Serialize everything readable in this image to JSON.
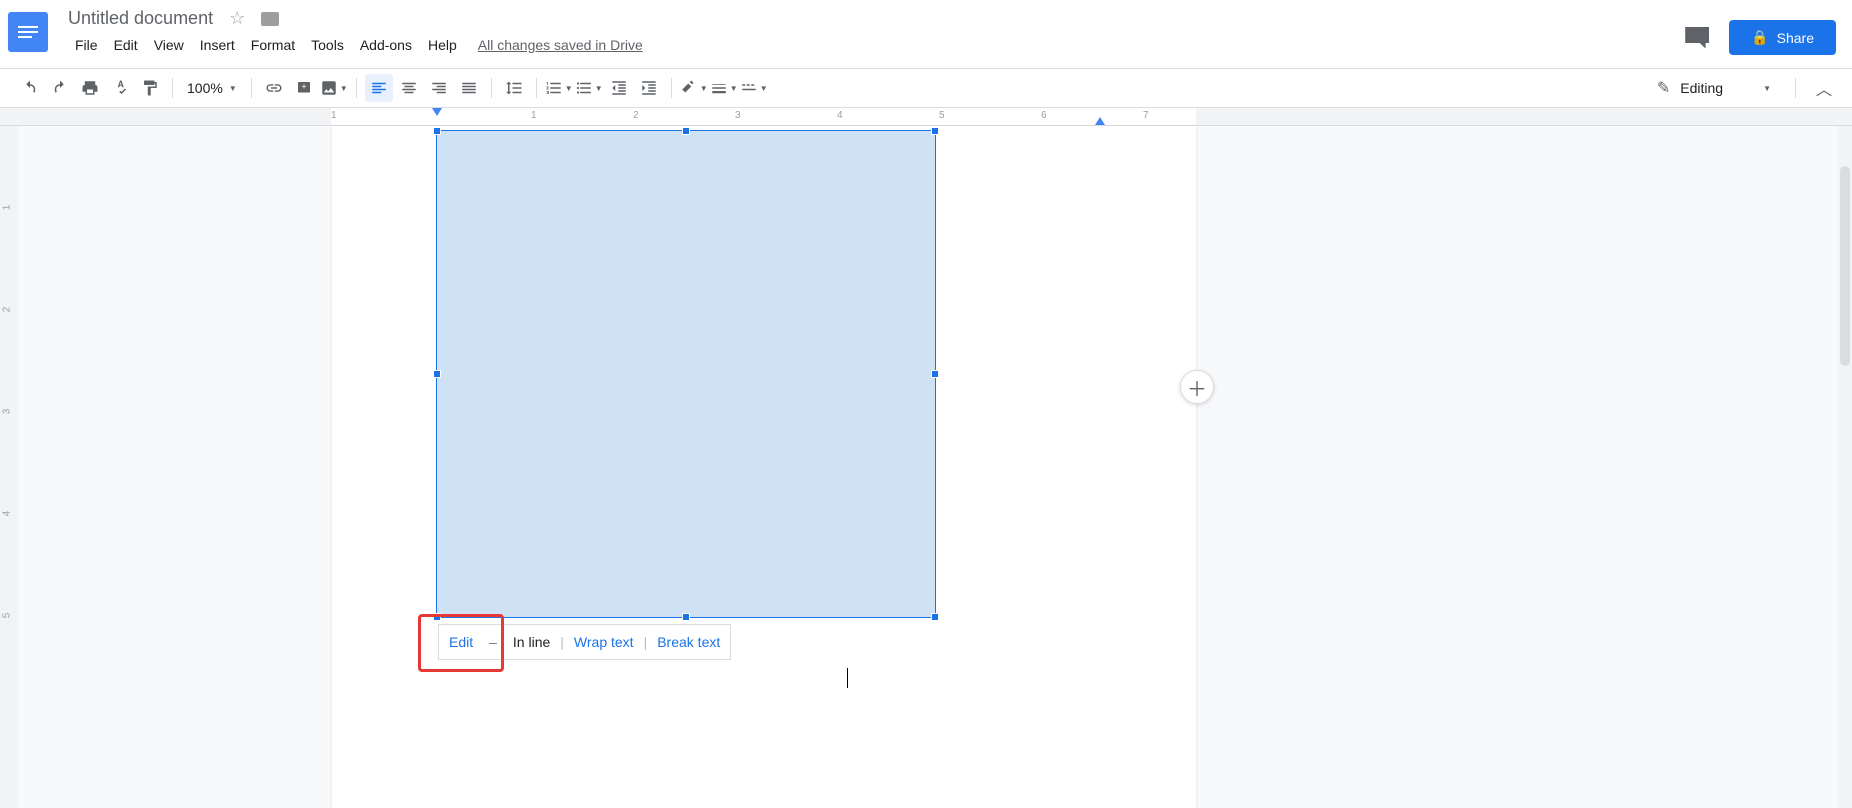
{
  "header": {
    "title": "Untitled document",
    "save_status": "All changes saved in Drive",
    "share_label": "Share"
  },
  "menu": {
    "items": [
      "File",
      "Edit",
      "View",
      "Insert",
      "Format",
      "Tools",
      "Add-ons",
      "Help"
    ]
  },
  "toolbar": {
    "zoom": "100%",
    "editing_label": "Editing"
  },
  "ruler": {
    "horizontal": [
      "1",
      "1",
      "2",
      "3",
      "4",
      "5",
      "6",
      "7"
    ],
    "vertical": [
      "1",
      "2",
      "3",
      "4",
      "5"
    ]
  },
  "context_toolbar": {
    "edit": "Edit",
    "inline": "In line",
    "wrap": "Wrap text",
    "break": "Break text"
  }
}
